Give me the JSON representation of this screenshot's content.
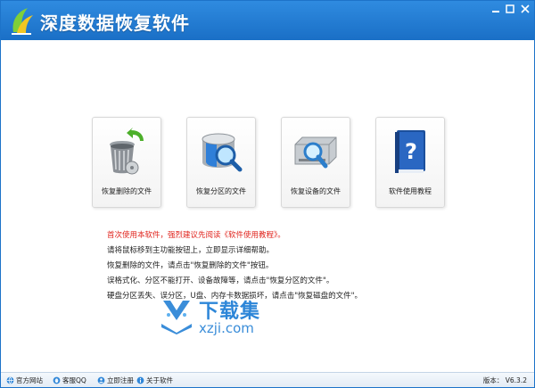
{
  "window": {
    "title": "深度数据恢复软件",
    "minimize_label": "",
    "maximize_label": "",
    "close_label": ""
  },
  "cards": [
    {
      "label": "恢复删除的文件",
      "icon": "trash-bin-icon"
    },
    {
      "label": "恢复分区的文件",
      "icon": "disk-search-icon"
    },
    {
      "label": "恢复设备的文件",
      "icon": "device-search-icon"
    },
    {
      "label": "软件使用教程",
      "icon": "help-book-icon"
    }
  ],
  "help": {
    "lines": [
      "首次使用本软件，强烈建议先阅读《软件使用教程》。",
      "请将鼠标移到主功能按钮上，立即显示详细帮助。",
      "恢复删除的文件，请点击\"恢复删除的文件\"按钮。",
      "误格式化、分区不能打开、设备故障等，请点击\"恢复分区的文件\"。",
      "硬盘分区丢失、误分区，U盘、内存卡数据损坏，请点击\"恢复磁盘的文件\"。"
    ]
  },
  "watermark": {
    "title": "下载集",
    "url": "xzji.com"
  },
  "statusbar": {
    "links": [
      {
        "label": "官方网站",
        "icon": "globe-icon"
      },
      {
        "label": "客服QQ",
        "icon": "qq-icon"
      },
      {
        "label": "立即注册",
        "icon": "register-icon"
      },
      {
        "label": "关于软件",
        "icon": "info-icon"
      }
    ],
    "version": "版本： V6.3.2"
  },
  "colors": {
    "titlebar": "#2f8be0",
    "warning_text": "#e0231c",
    "watermark": "#2d86d8"
  }
}
